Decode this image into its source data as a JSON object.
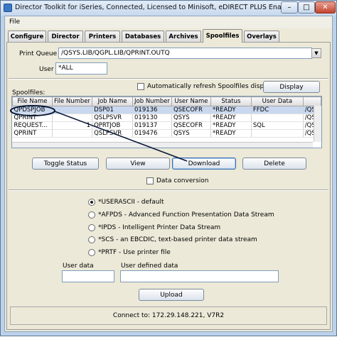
{
  "window": {
    "title": "Director Toolkit for iSeries, Connected, Licensed to Minisoft, eDIRECT PLUS Enabled",
    "minimize_glyph": "–",
    "maximize_glyph": "□",
    "close_glyph": "✕"
  },
  "menu": {
    "file": "File"
  },
  "tabs": [
    {
      "label": "Configure"
    },
    {
      "label": "Director"
    },
    {
      "label": "Printers"
    },
    {
      "label": "Databases"
    },
    {
      "label": "Archives"
    },
    {
      "label": "Spoolfiles",
      "active": true
    },
    {
      "label": "Overlays"
    }
  ],
  "print_queue": {
    "label": "Print Queue",
    "value": "/QSYS.LIB/QGPL.LIB/QPRINT.OUTQ"
  },
  "user": {
    "label": "User",
    "value": "*ALL"
  },
  "spoolfiles": {
    "label": "Spoolfiles:",
    "auto_refresh_label": "Automatically refresh Spoolfiles display",
    "auto_refresh_checked": false,
    "display_button": "Display",
    "columns": [
      "File Name",
      "File Number",
      "Job Name",
      "Job Number",
      "User Name",
      "Status",
      "User Data",
      ""
    ],
    "rows": [
      [
        "QPDSPJOB",
        "",
        "DSP01",
        "019136",
        "QSECOFR",
        "*READY",
        "FFDC",
        "/QSY"
      ],
      [
        "QPRINT",
        "",
        "QSLPSVR",
        "019130",
        "QSYS",
        "*READY",
        "",
        "/QSY"
      ],
      [
        "REQUEST...",
        "1",
        "QPRTJOB",
        "019137",
        "QSECOFR",
        "*READY",
        "SQL",
        "/QSY"
      ],
      [
        "QPRINT",
        "",
        "QSLPSVR",
        "019476",
        "QSYS",
        "*READY",
        "",
        "/QSY"
      ]
    ],
    "selected_row": 0
  },
  "actions": {
    "toggle_status": "Toggle Status",
    "view": "View",
    "download": "Download",
    "delete": "Delete"
  },
  "data_conversion": {
    "label": "Data conversion",
    "checked": false
  },
  "formats": [
    {
      "label": "*USERASCII - default",
      "selected": true
    },
    {
      "label": "*AFPDS - Advanced Function Presentation Data Stream",
      "selected": false
    },
    {
      "label": "*IPDS - Intelligent Printer Data Stream",
      "selected": false
    },
    {
      "label": "*SCS - an EBCDIC, text-based printer data stream",
      "selected": false
    },
    {
      "label": "*PRTF - Use printer file",
      "selected": false
    }
  ],
  "user_data": {
    "label": "User data",
    "value": ""
  },
  "user_defined_data": {
    "label": "User defined data",
    "value": ""
  },
  "upload_button": "Upload",
  "status": {
    "text": "Connect to: 172.29.148.221, V7R2"
  },
  "colors": {
    "annotation": "#0b1a3a",
    "selection": "#c9d8ef",
    "titlebar": "#c7d9ee"
  }
}
